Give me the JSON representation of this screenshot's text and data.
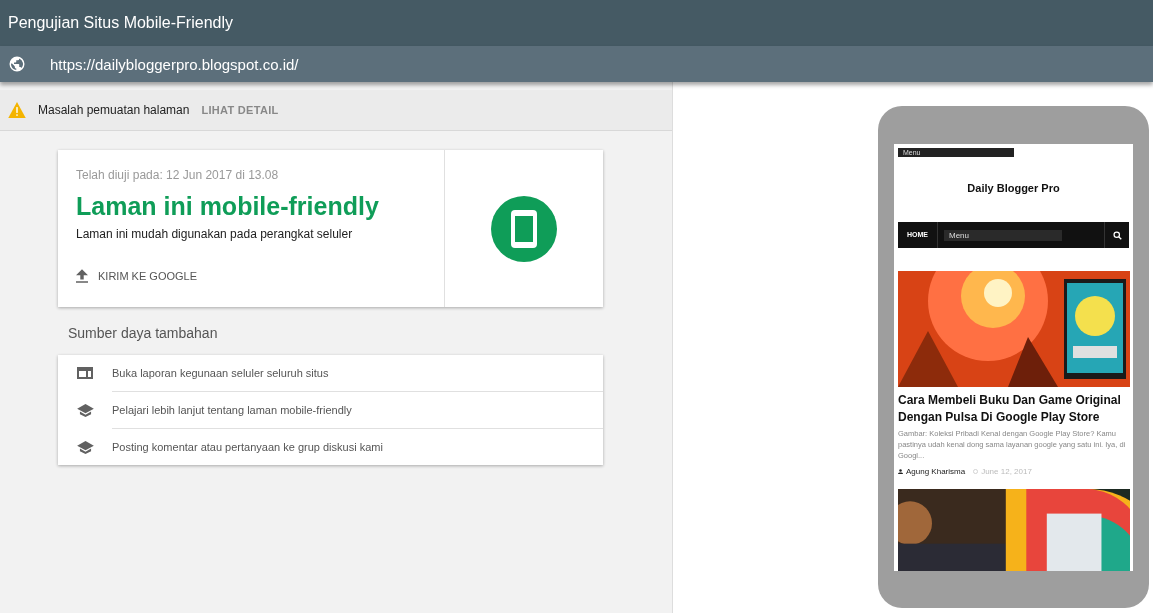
{
  "window": {
    "title": "Pengujian Situs Mobile-Friendly"
  },
  "url": "https://dailybloggerpro.blogspot.co.id/",
  "warning": {
    "text": "Masalah pemuatan halaman",
    "link": "LIHAT DETAIL"
  },
  "result": {
    "tested": "Telah diuji pada: 12 Jun 2017 di 13.08",
    "heading": "Laman ini mobile-friendly",
    "subtitle": "Laman ini mudah digunakan pada perangkat seluler",
    "action": "KIRIM KE GOOGLE"
  },
  "resources": {
    "heading": "Sumber daya tambahan",
    "items": [
      {
        "kind": "report",
        "text": "Buka laporan kegunaan seluler seluruh situs"
      },
      {
        "kind": "school",
        "text": "Pelajari lebih lanjut tentang laman mobile-friendly"
      },
      {
        "kind": "school",
        "text": "Posting komentar atau pertanyaan ke grup diskusi kami"
      }
    ]
  },
  "preview": {
    "top_menu": "Menu",
    "site_title": "Daily Blogger Pro",
    "nav_home": "HOME",
    "nav_menu": "Menu",
    "post": {
      "title": "Cara Membeli Buku Dan Game Original Dengan Pulsa Di Google Play Store",
      "excerpt": "Gambar: Koleksi Pribadi Kenal dengan Google Play Store? Kamu pastinya udah kenal dong sama layanan google yang satu ini. Iya, di Googl...",
      "author": "Agung Kharisma",
      "date": "June 12, 2017"
    }
  }
}
